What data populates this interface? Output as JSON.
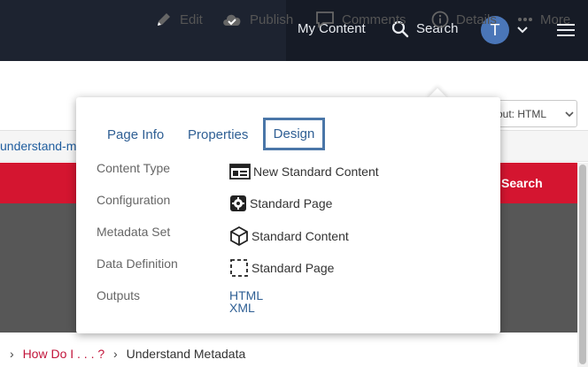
{
  "nav": {
    "my_content": "My Content",
    "search": "Search",
    "avatar_initial": "T"
  },
  "toolbar": {
    "edit": "Edit",
    "publish": "Publish",
    "comments": "Comments",
    "details": "Details",
    "more": "More"
  },
  "page": {
    "layout_select": "out: HTML",
    "breadcrumb_link": "understand-m",
    "red_band_search": "Search",
    "bottom_crumbs": {
      "howdo": "How Do I . . . ?",
      "current": "Understand Metadata"
    }
  },
  "popover": {
    "tabs": [
      "Page Info",
      "Properties",
      "Design"
    ],
    "active_tab": "Design",
    "rows": [
      {
        "label": "Content Type",
        "value": "New Standard Content",
        "icon": "content-type-icon"
      },
      {
        "label": "Configuration",
        "value": "Standard Page",
        "icon": "gear-icon"
      },
      {
        "label": "Metadata Set",
        "value": "Standard Content",
        "icon": "cube-icon"
      },
      {
        "label": "Data Definition",
        "value": "Standard Page",
        "icon": "dashed-box-icon"
      }
    ],
    "outputs_label": "Outputs",
    "outputs": [
      "HTML",
      "XML"
    ]
  },
  "colors": {
    "navbar": "#1d2330",
    "accent_red": "#d41530",
    "link_blue": "#2f5f94",
    "active_tab_border": "#4a76a8"
  }
}
